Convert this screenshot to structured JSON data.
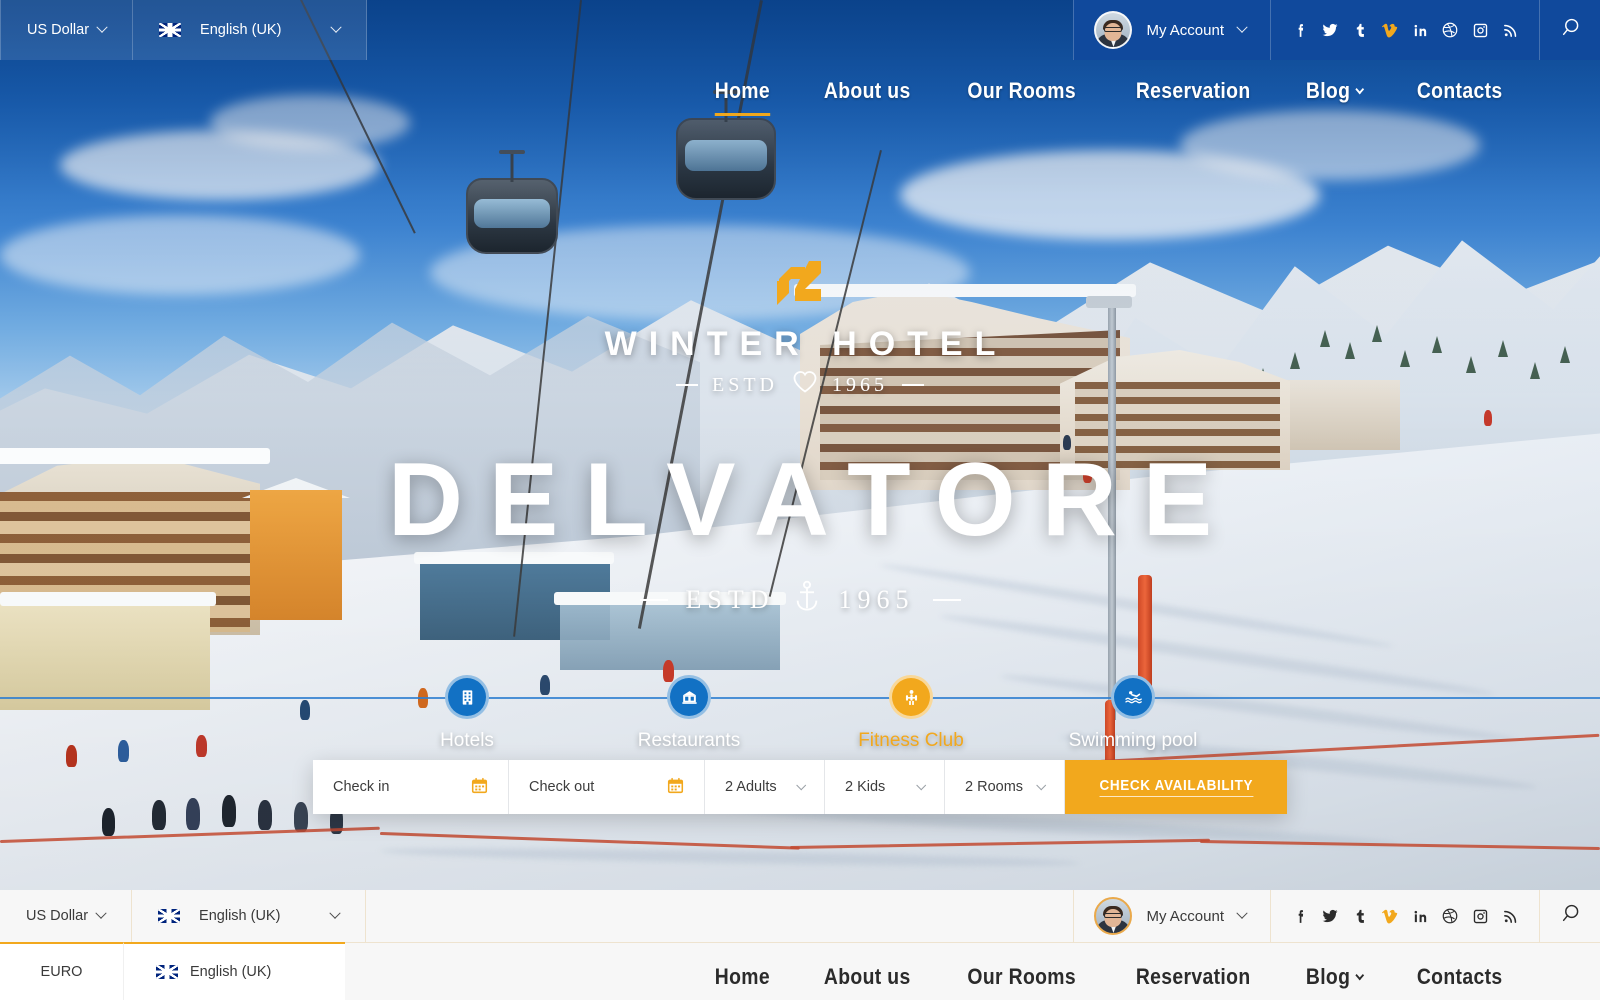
{
  "topbar": {
    "currency": "US Dollar",
    "language": "English (UK)",
    "account": "My Account",
    "social": [
      "facebook",
      "twitter",
      "tumblr",
      "vimeo",
      "linkedin",
      "dribbble",
      "instagram",
      "rss"
    ],
    "search_icon": "search-icon",
    "flag_icon": "uk-flag-icon"
  },
  "nav": {
    "items": [
      {
        "label": "Home",
        "active": true,
        "dropdown": false
      },
      {
        "label": "About us",
        "active": false,
        "dropdown": false
      },
      {
        "label": "Our Rooms",
        "active": false,
        "dropdown": false
      },
      {
        "label": "Reservation",
        "active": false,
        "dropdown": false
      },
      {
        "label": "Blog",
        "active": false,
        "dropdown": true
      },
      {
        "label": "Contacts",
        "active": false,
        "dropdown": false
      }
    ]
  },
  "hero": {
    "logo_icon": "delvatore-s-logo",
    "subtitle": "WINTER HOTEL",
    "estd_top": {
      "left": "ESTD",
      "icon": "heart-icon",
      "right": "1965"
    },
    "title": "DELVATORE",
    "estd_bottom": {
      "left": "ESTD",
      "icon": "anchor-icon",
      "right": "1965"
    }
  },
  "steps": [
    {
      "label": "Hotels",
      "icon": "hotel-building-icon",
      "active": false
    },
    {
      "label": "Restaurants",
      "icon": "restaurant-icon",
      "active": false
    },
    {
      "label": "Fitness Club",
      "icon": "fitness-icon",
      "active": true
    },
    {
      "label": "Swimming pool",
      "icon": "swimmer-icon",
      "active": false
    }
  ],
  "booking": {
    "checkin_placeholder": "Check in",
    "checkout_placeholder": "Check out",
    "adults": "2 Adults",
    "kids": "2 Kids",
    "rooms": "2 Rooms",
    "submit": "CHECK AVAILABILITY",
    "calendar_icon": "calendar-icon"
  },
  "bottombar": {
    "currency": "US Dollar",
    "language": "English (UK)",
    "account": "My Account",
    "social": [
      "facebook",
      "twitter",
      "tumblr",
      "vimeo",
      "linkedin",
      "dribbble",
      "instagram",
      "rss"
    ]
  },
  "dropdowns": {
    "currency_option": "EURO",
    "language_option": "English (UK)"
  },
  "bottomnav": {
    "items": [
      {
        "label": "Home",
        "dropdown": false
      },
      {
        "label": "About us",
        "dropdown": false
      },
      {
        "label": "Our Rooms",
        "dropdown": false
      },
      {
        "label": "Reservation",
        "dropdown": false
      },
      {
        "label": "Blog",
        "dropdown": true
      },
      {
        "label": "Contacts",
        "dropdown": false
      }
    ]
  },
  "colors": {
    "accent": "#f2a81d",
    "brand_blue": "#10499c",
    "step_blue": "#1271c4"
  }
}
